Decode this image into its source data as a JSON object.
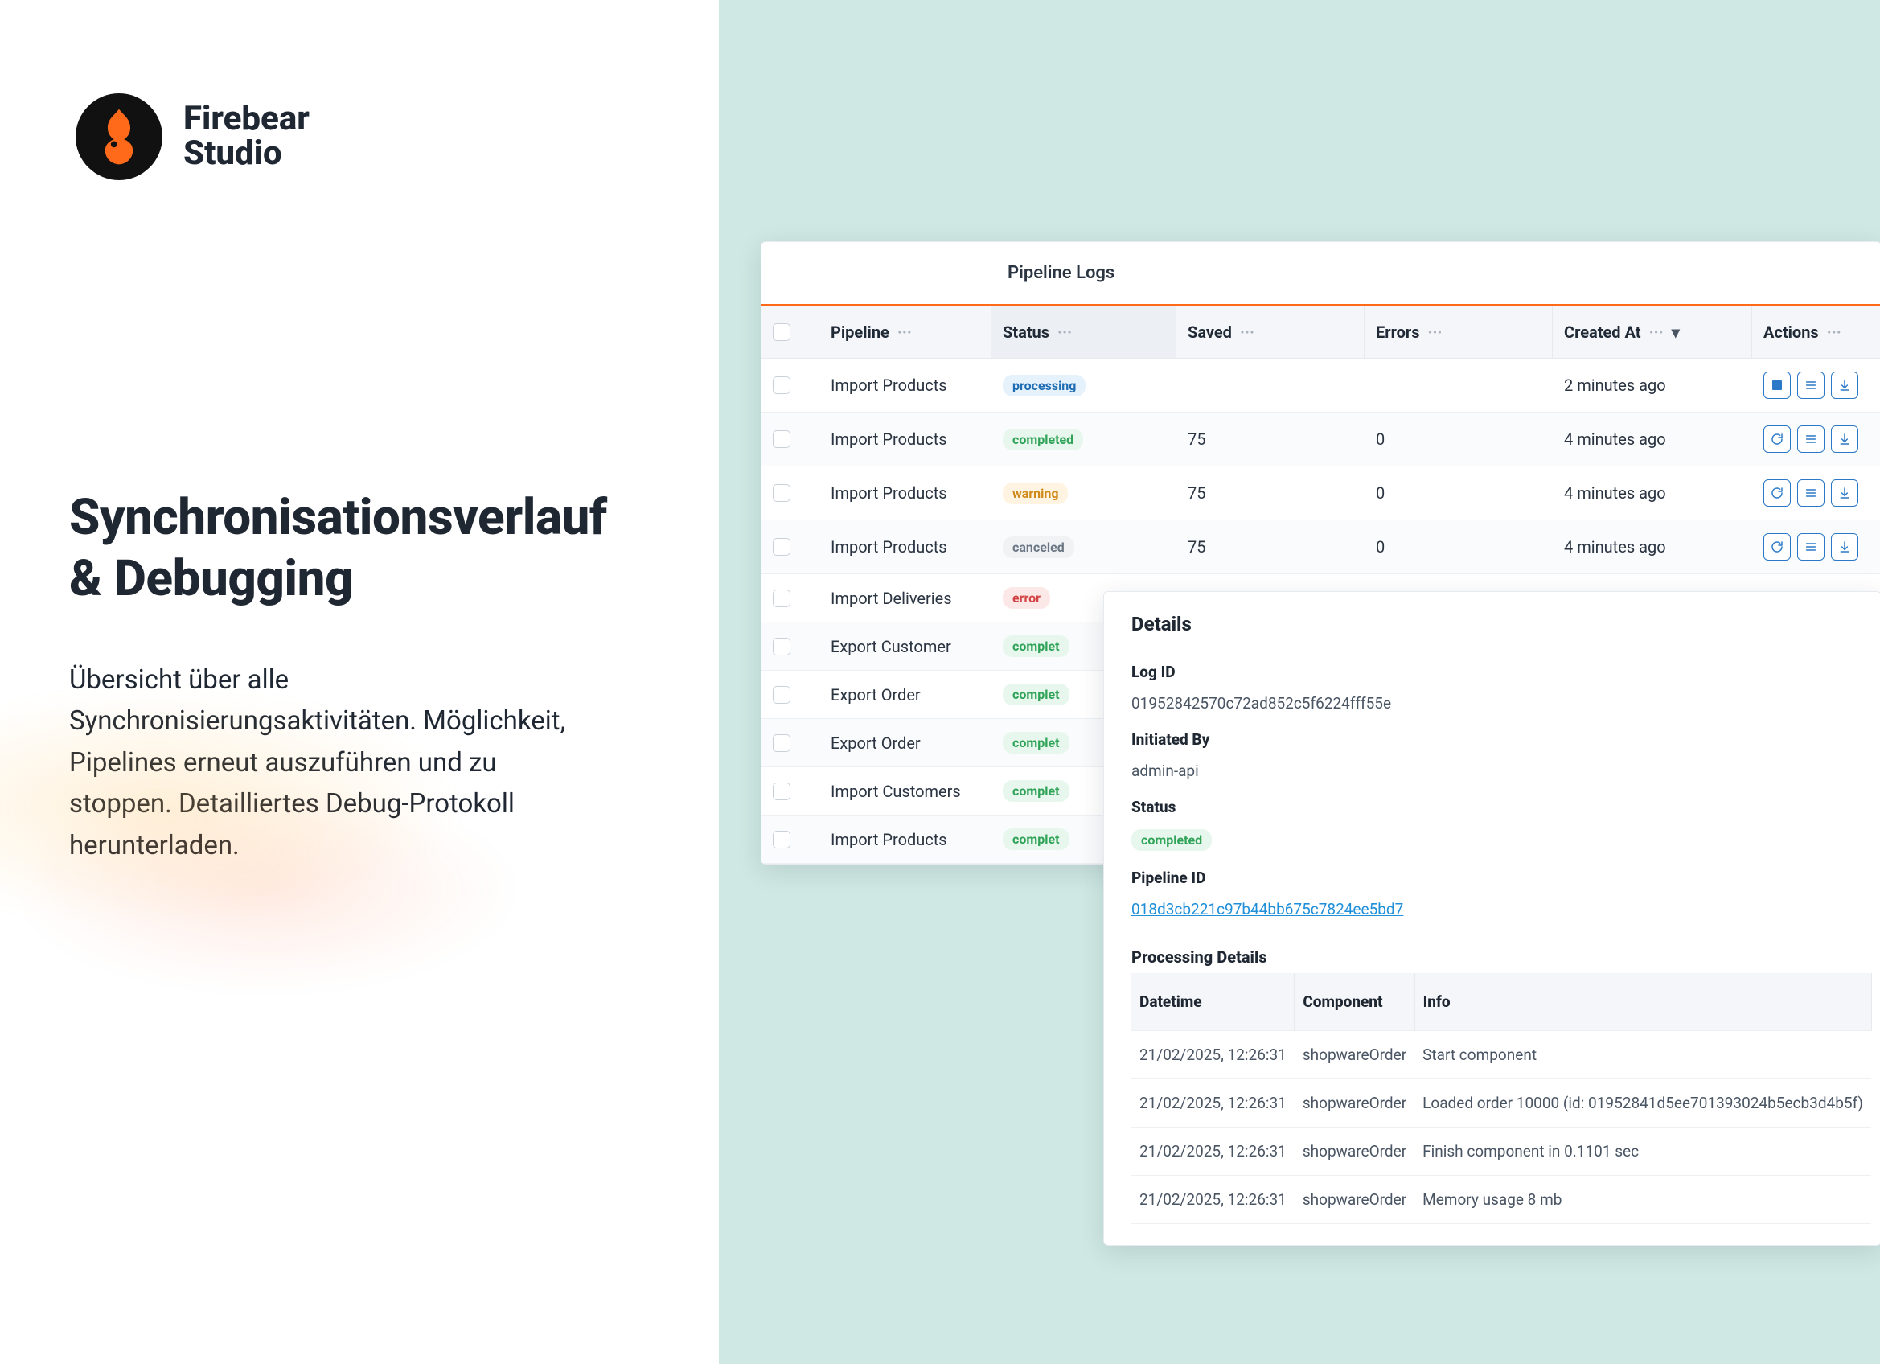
{
  "brand": {
    "line1": "Firebear",
    "line2": "Studio"
  },
  "headline": {
    "l1": "Synchronisationsverlauf",
    "l2": "& Debugging"
  },
  "copy": "Übersicht über alle Synchronisierungsaktivitäten. Möglichkeit, Pipelines erneut auszuführen und zu stoppen. Detailliertes Debug-Protokoll herunterladen.",
  "logs": {
    "title": "Pipeline Logs",
    "columns": {
      "pipeline": "Pipeline",
      "status": "Status",
      "saved": "Saved",
      "errors": "Errors",
      "created": "Created At",
      "actions": "Actions"
    },
    "rows": [
      {
        "pipeline": "Import Products",
        "status": "processing",
        "saved": "",
        "errors": "",
        "created": "2 minutes ago",
        "actions": "stop"
      },
      {
        "pipeline": "Import Products",
        "status": "completed",
        "saved": "75",
        "errors": "0",
        "created": "4 minutes ago",
        "actions": "rerun"
      },
      {
        "pipeline": "Import Products",
        "status": "warning",
        "saved": "75",
        "errors": "0",
        "created": "4 minutes ago",
        "actions": "rerun"
      },
      {
        "pipeline": "Import Products",
        "status": "canceled",
        "saved": "75",
        "errors": "0",
        "created": "4 minutes ago",
        "actions": "rerun"
      },
      {
        "pipeline": "Import Deliveries",
        "status": "error",
        "saved": "",
        "errors": "",
        "created": "",
        "actions": ""
      },
      {
        "pipeline": "Export Customer",
        "status": "completed",
        "saved": "",
        "errors": "",
        "created": "",
        "actions": ""
      },
      {
        "pipeline": "Export Order",
        "status": "completed",
        "saved": "",
        "errors": "",
        "created": "",
        "actions": ""
      },
      {
        "pipeline": "Export Order",
        "status": "completed",
        "saved": "",
        "errors": "",
        "created": "",
        "actions": ""
      },
      {
        "pipeline": "Import Customers",
        "status": "completed",
        "saved": "",
        "errors": "",
        "created": "",
        "actions": ""
      },
      {
        "pipeline": "Import Products",
        "status": "completed",
        "saved": "",
        "errors": "",
        "created": "",
        "actions": ""
      }
    ]
  },
  "details": {
    "title": "Details",
    "labels": {
      "logId": "Log ID",
      "initiatedBy": "Initiated By",
      "status": "Status",
      "pipelineId": "Pipeline ID",
      "processing": "Processing Details",
      "datetime": "Datetime",
      "component": "Component",
      "info": "Info"
    },
    "logId": "01952842570c72ad852c5f6224fff55e",
    "initiatedBy": "admin-api",
    "status": "completed",
    "pipelineId": "018d3cb221c97b44bb675c7824ee5bd7",
    "rows": [
      {
        "datetime": "21/02/2025, 12:26:31",
        "component": "shopwareOrder",
        "info": "Start component"
      },
      {
        "datetime": "21/02/2025, 12:26:31",
        "component": "shopwareOrder",
        "info": "Loaded order 10000 (id: 01952841d5ee701393024b5ecb3d4b5f)"
      },
      {
        "datetime": "21/02/2025, 12:26:31",
        "component": "shopwareOrder",
        "info": "Finish component in 0.1101 sec"
      },
      {
        "datetime": "21/02/2025, 12:26:31",
        "component": "shopwareOrder",
        "info": "Memory usage 8 mb"
      }
    ]
  }
}
